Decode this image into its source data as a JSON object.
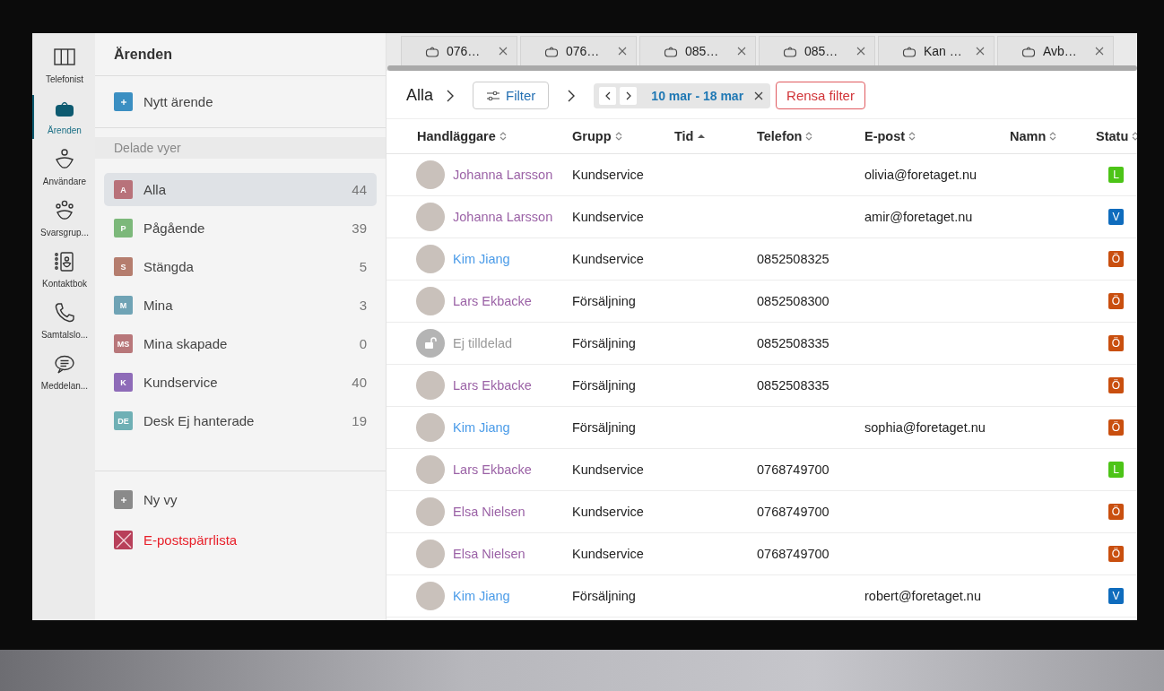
{
  "rail": [
    {
      "label": "Telefonist",
      "kind": "columns",
      "selected": false
    },
    {
      "label": "Ärenden",
      "kind": "briefcase",
      "selected": true
    },
    {
      "label": "Användare",
      "kind": "person",
      "selected": false
    },
    {
      "label": "Svarsgrup...",
      "kind": "group",
      "selected": false
    },
    {
      "label": "Kontaktbok",
      "kind": "contacts",
      "selected": false
    },
    {
      "label": "Samtalslo...",
      "kind": "phone",
      "selected": false
    },
    {
      "label": "Meddelan...",
      "kind": "chat",
      "selected": false
    }
  ],
  "sidebar": {
    "title": "Ärenden",
    "new_button": "Nytt ärende",
    "section": "Delade vyer",
    "views": [
      {
        "badge": "A",
        "color": "#b8727a",
        "label": "Alla",
        "count": "44",
        "selected": true
      },
      {
        "badge": "P",
        "color": "#7cb87a",
        "label": "Pågående",
        "count": "39",
        "selected": false
      },
      {
        "badge": "S",
        "color": "#b57d6e",
        "label": "Stängda",
        "count": "5",
        "selected": false
      },
      {
        "badge": "M",
        "color": "#6fa3b5",
        "label": "Mina",
        "count": "3",
        "selected": false
      },
      {
        "badge": "MS",
        "color": "#b8777a",
        "label": "Mina skapade",
        "count": "0",
        "selected": false
      },
      {
        "badge": "K",
        "color": "#8e6bb8",
        "label": "Kundservice",
        "count": "40",
        "selected": false
      },
      {
        "badge": "DE",
        "color": "#6fb0b5",
        "label": "Desk Ej hanterade",
        "count": "19",
        "selected": false
      }
    ],
    "footer": [
      {
        "kind": "add",
        "label": "Ny vy"
      },
      {
        "kind": "blocklist",
        "label": "E-postspärrlista"
      }
    ]
  },
  "tabs": [
    {
      "label": "076…"
    },
    {
      "label": "076…"
    },
    {
      "label": "085…"
    },
    {
      "label": "085…"
    },
    {
      "label": "Kan …"
    },
    {
      "label": "Avb…"
    }
  ],
  "toolbar": {
    "breadcrumb": "Alla",
    "filter_button": "Filter",
    "date_range": "10 mar - 18 mar",
    "clear_button": "Rensa filter"
  },
  "table": {
    "columns": [
      {
        "label": "Handläggare",
        "sorted": false
      },
      {
        "label": "Grupp",
        "sorted": false
      },
      {
        "label": "Tid",
        "sorted": true
      },
      {
        "label": "Telefon",
        "sorted": false
      },
      {
        "label": "E-post",
        "sorted": false
      },
      {
        "label": "Namn",
        "sorted": false
      },
      {
        "label": "Statu",
        "sorted": false
      }
    ],
    "rows": [
      {
        "handler": {
          "kind": "photo",
          "name": "Johanna Larsson",
          "color": "#9b62a6"
        },
        "group": "Kundservice",
        "email": "olivia@foretaget.nu",
        "status": {
          "letter": "L",
          "color": "#4cc417"
        }
      },
      {
        "handler": {
          "kind": "photo",
          "name": "Johanna Larsson",
          "color": "#9b62a6"
        },
        "group": "Kundservice",
        "email": "amir@foretaget.nu",
        "status": {
          "letter": "V",
          "color": "#0f6cbd"
        }
      },
      {
        "handler": {
          "kind": "photo",
          "name": "Kim Jiang",
          "color": "#4a9be8"
        },
        "group": "Kundservice",
        "phone": "0852508325",
        "status": {
          "letter": "Ö",
          "color": "#c94f0f"
        }
      },
      {
        "handler": {
          "kind": "photo",
          "name": "Lars Ekbacke",
          "color": "#9b62a6"
        },
        "group": "Försäljning",
        "phone": "0852508300",
        "status": {
          "letter": "Ö",
          "color": "#c94f0f"
        }
      },
      {
        "handler": {
          "kind": "unassigned",
          "name": "Ej tilldelad",
          "color": "#9a9a9a"
        },
        "group": "Försäljning",
        "phone": "0852508335",
        "status": {
          "letter": "Ö",
          "color": "#c94f0f"
        }
      },
      {
        "handler": {
          "kind": "photo",
          "name": "Lars Ekbacke",
          "color": "#9b62a6"
        },
        "group": "Försäljning",
        "phone": "0852508335",
        "status": {
          "letter": "Ö",
          "color": "#c94f0f"
        }
      },
      {
        "handler": {
          "kind": "photo",
          "name": "Kim Jiang",
          "color": "#4a9be8"
        },
        "group": "Försäljning",
        "email": "sophia@foretaget.nu",
        "status": {
          "letter": "Ö",
          "color": "#c94f0f"
        }
      },
      {
        "handler": {
          "kind": "photo",
          "name": "Lars Ekbacke",
          "color": "#9b62a6"
        },
        "group": "Kundservice",
        "phone": "0768749700",
        "status": {
          "letter": "L",
          "color": "#4cc417"
        }
      },
      {
        "handler": {
          "kind": "photo",
          "name": "Elsa Nielsen",
          "color": "#9b62a6"
        },
        "group": "Kundservice",
        "phone": "0768749700",
        "status": {
          "letter": "Ö",
          "color": "#c94f0f"
        }
      },
      {
        "handler": {
          "kind": "photo",
          "name": "Elsa Nielsen",
          "color": "#9b62a6"
        },
        "group": "Kundservice",
        "phone": "0768749700",
        "status": {
          "letter": "Ö",
          "color": "#c94f0f"
        }
      },
      {
        "handler": {
          "kind": "photo",
          "name": "Kim Jiang",
          "color": "#4a9be8"
        },
        "group": "Försäljning",
        "email": "robert@foretaget.nu",
        "status": {
          "letter": "V",
          "color": "#0f6cbd"
        }
      }
    ]
  }
}
